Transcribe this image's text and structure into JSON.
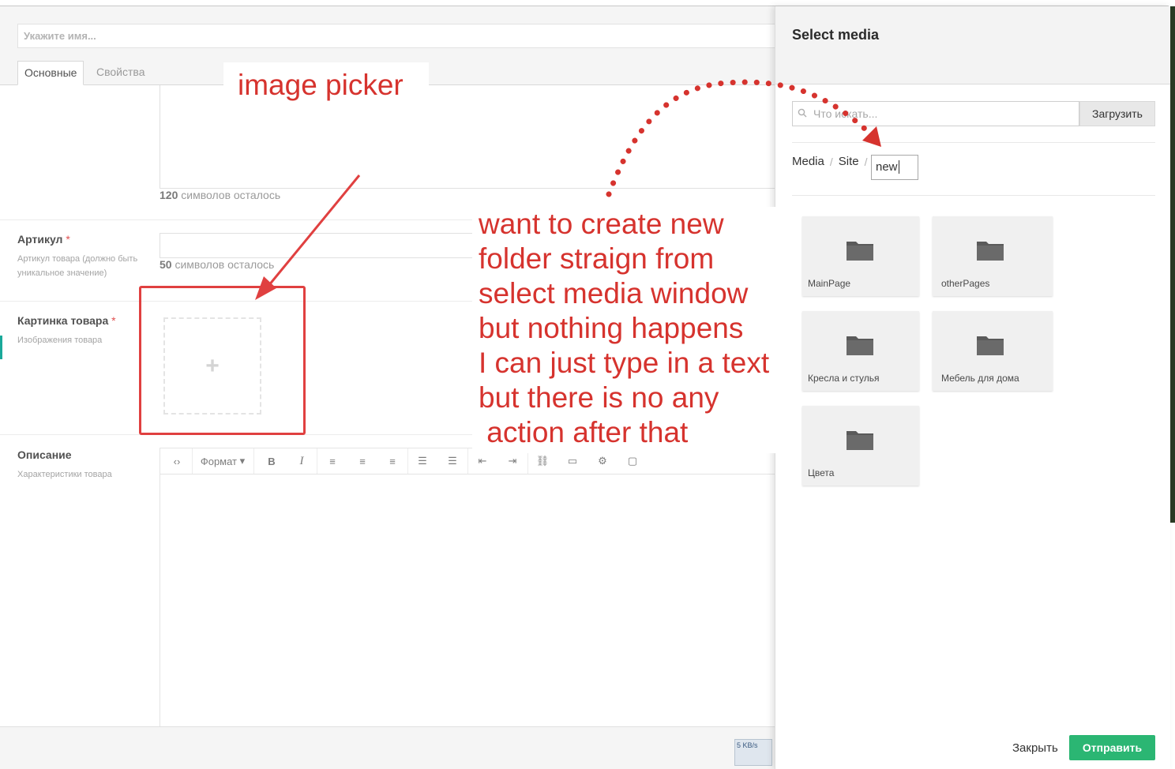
{
  "editor": {
    "name_placeholder": "Укажите имя...",
    "tabs": [
      {
        "label": "Основные",
        "active": true
      },
      {
        "label": "Свойства",
        "active": false
      }
    ],
    "meta_counter": {
      "value": "120",
      "suffix": " символов осталось"
    },
    "sku": {
      "label": "Артикул",
      "required_mark": "*",
      "description": "Артикул товара (должно быть уникальное значение)",
      "counter_value": "50",
      "counter_suffix": " символов осталось"
    },
    "image": {
      "label": "Картинка товара",
      "required_mark": "*",
      "description": "Изображения товара",
      "add_glyph": "+"
    },
    "description": {
      "label": "Описание",
      "sub": "Характеристики товара"
    },
    "toolbar": {
      "format_label": "Формат",
      "buttons": [
        "source-icon",
        "bold-icon",
        "italic-icon",
        "align-left-icon",
        "align-center-icon",
        "align-right-icon",
        "bullet-list-icon",
        "numbered-list-icon",
        "outdent-icon",
        "indent-icon",
        "link-icon",
        "image-icon",
        "settings-icon",
        "preview-icon"
      ]
    },
    "net_widget": {
      "speed": "5 KB/s"
    }
  },
  "media_panel": {
    "title": "Select media",
    "search_placeholder": "Что искать...",
    "upload_label": "Загрузить",
    "breadcrumb": [
      "Media",
      "Site"
    ],
    "new_folder_value": "new",
    "folders": [
      {
        "name": "MainPage"
      },
      {
        "name": "otherPages"
      },
      {
        "name": "Кресла и стулья"
      },
      {
        "name": "Мебель для дома"
      },
      {
        "name": "Цвета"
      }
    ],
    "close_label": "Закрыть",
    "submit_label": "Отправить"
  },
  "annotations": {
    "picker_label": "image picker",
    "note": "want to create new\nfolder straign from\nselect media window\nbut nothing happens\nI can just type in a text\nbut there is no any\n action after that",
    "color": "#d6332e"
  },
  "colors": {
    "accent_green": "#2bb673",
    "teal_marker": "#1aa99a"
  }
}
